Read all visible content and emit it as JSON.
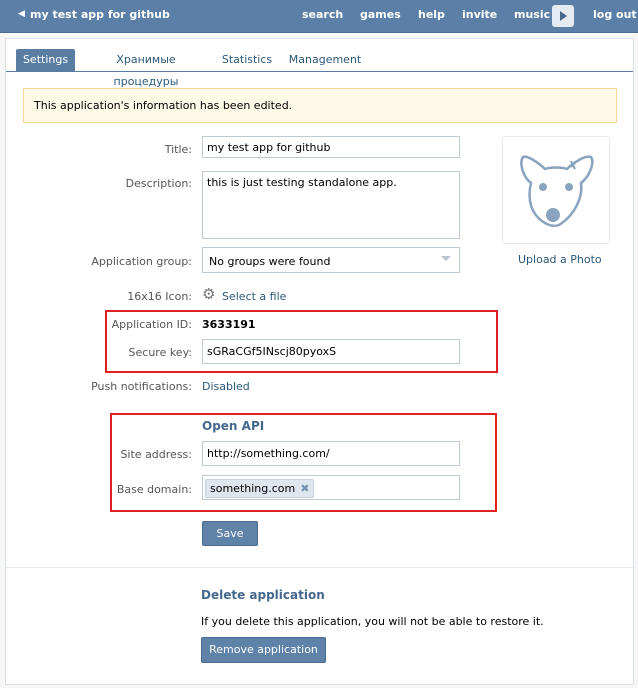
{
  "topbar": {
    "back_icon": "chevron-left-icon",
    "app_title": "my test app for github",
    "nav": [
      "search",
      "games",
      "help",
      "invite",
      "music"
    ],
    "logout": "log out"
  },
  "tabs": [
    "Settings",
    "Хранимые процедуры",
    "Statistics",
    "Management"
  ],
  "notice": "This application's information has been edited.",
  "form": {
    "title_label": "Title:",
    "title_value": "my test app for github",
    "description_label": "Description:",
    "description_value": "this is just testing standalone app.",
    "group_label": "Application group:",
    "group_value": "No groups were found",
    "icon_label": "16x16 Icon:",
    "icon_link": "Select a file",
    "app_id_label": "Application ID:",
    "app_id_value": "3633191",
    "secure_key_label": "Secure key:",
    "secure_key_value": "sGRaCGf5INscj80pyoxS",
    "push_label": "Push notifications:",
    "push_value": "Disabled"
  },
  "open_api": {
    "title": "Open API",
    "site_label": "Site address:",
    "site_value": "http://something.com/",
    "domain_label": "Base domain:",
    "domain_tag": "something.com"
  },
  "save_button": "Save",
  "upload_photo": "Upload a Photo",
  "delete": {
    "title": "Delete application",
    "text": "If you delete this application, you will not be able to restore it.",
    "button": "Remove application"
  },
  "colors": {
    "topbar": "#5b7fa6",
    "accent": "#597da3",
    "link": "#2b587a",
    "highlight": "#e02020",
    "notice_bg": "#fff9e8"
  }
}
